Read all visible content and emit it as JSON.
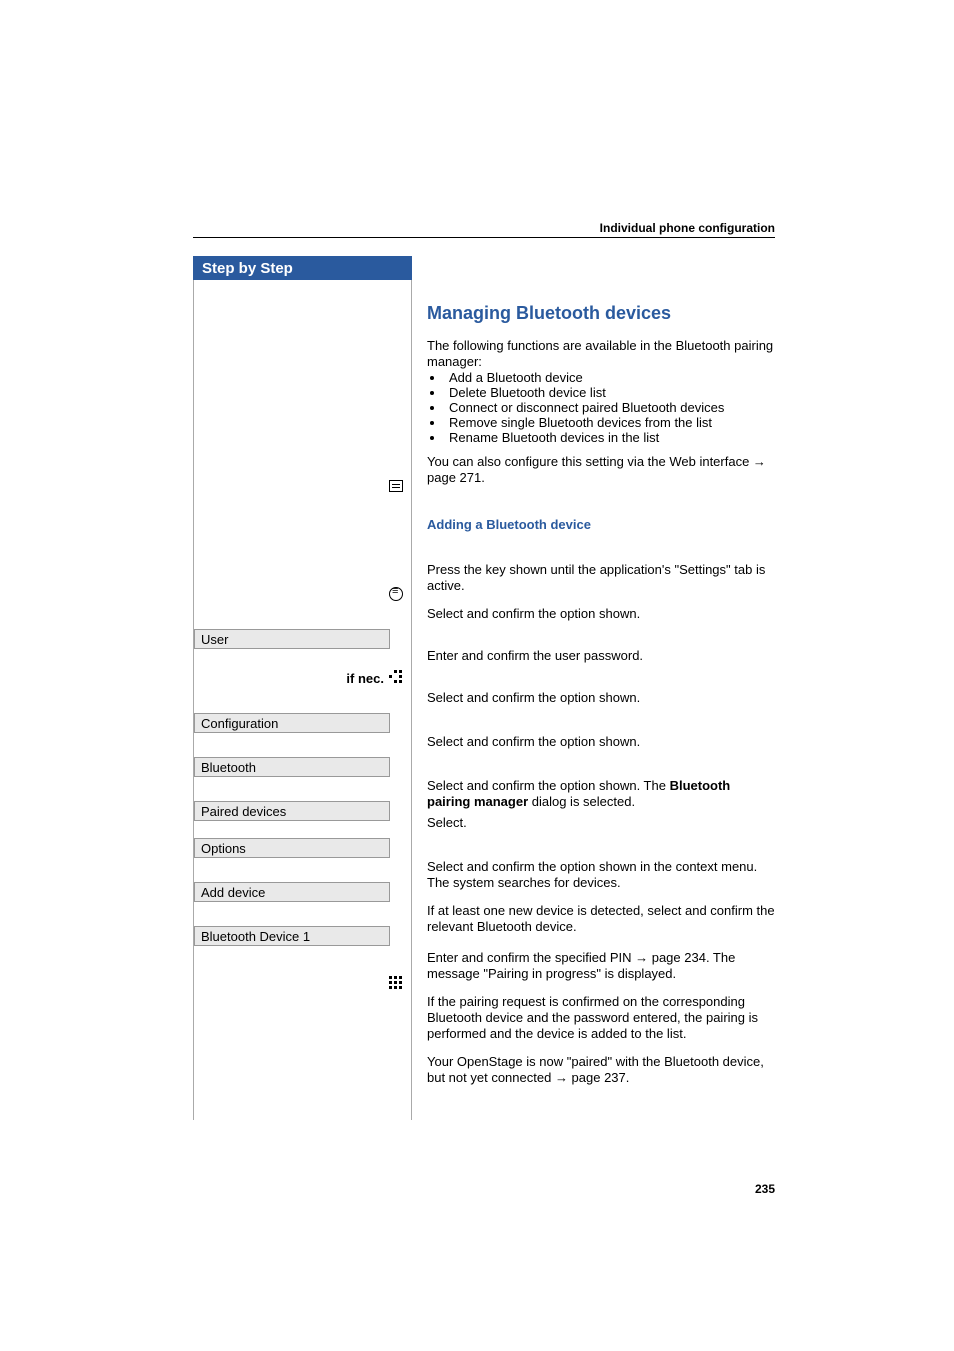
{
  "running_head": "Individual phone configuration",
  "page_number": "235",
  "sidebar": {
    "header": "Step by Step",
    "ifnec_label": "if nec.",
    "menu": {
      "user": "User",
      "configuration": "Configuration",
      "bluetooth": "Bluetooth",
      "paired_devices": "Paired devices",
      "options": "Options",
      "add_device": "Add device",
      "bt_device_1": "Bluetooth Device 1"
    }
  },
  "main": {
    "h2": "Managing Bluetooth devices",
    "intro": "The following functions are available in the Bluetooth pairing manager:",
    "bullets": [
      "Add a Bluetooth device",
      "Delete Bluetooth device list",
      "Connect or disconnect paired Bluetooth devices",
      "Remove single Bluetooth devices from the list",
      "Rename Bluetooth devices in the list"
    ],
    "web_note_a": "You can also configure this setting via the Web interface ",
    "web_note_arrow": "→",
    "web_note_b": " page 271.",
    "h4_adding": "Adding a Bluetooth device",
    "press_key": "Press the key shown until the application's \"Settings\" tab is active.",
    "select_confirm": "Select and confirm the option shown.",
    "enter_pw": "Enter and confirm the user password.",
    "paired_text_a": "Select and confirm the option shown. The ",
    "paired_bold": "Bluetooth pairing manager",
    "paired_text_b": " dialog is selected.",
    "select": "Select.",
    "add_device_text": "Select and confirm the option shown in the context menu. The system searches for devices.",
    "detect_text": "If at least one new device is detected, select and confirm the relevant Bluetooth device.",
    "pin_text_a": "Enter and confirm the specified PIN ",
    "pin_arrow": "→",
    "pin_text_b": " page 234. The message \"Pairing in progress\" is displayed.",
    "pairing_req": "If the pairing request is confirmed on the corresponding Bluetooth device and the password entered, the pairing is performed and the device is added to the list.",
    "paired_final_a": "Your OpenStage is now \"paired\" with the Bluetooth device, but not yet connected ",
    "paired_final_arrow": "→",
    "paired_final_b": " page 237."
  }
}
